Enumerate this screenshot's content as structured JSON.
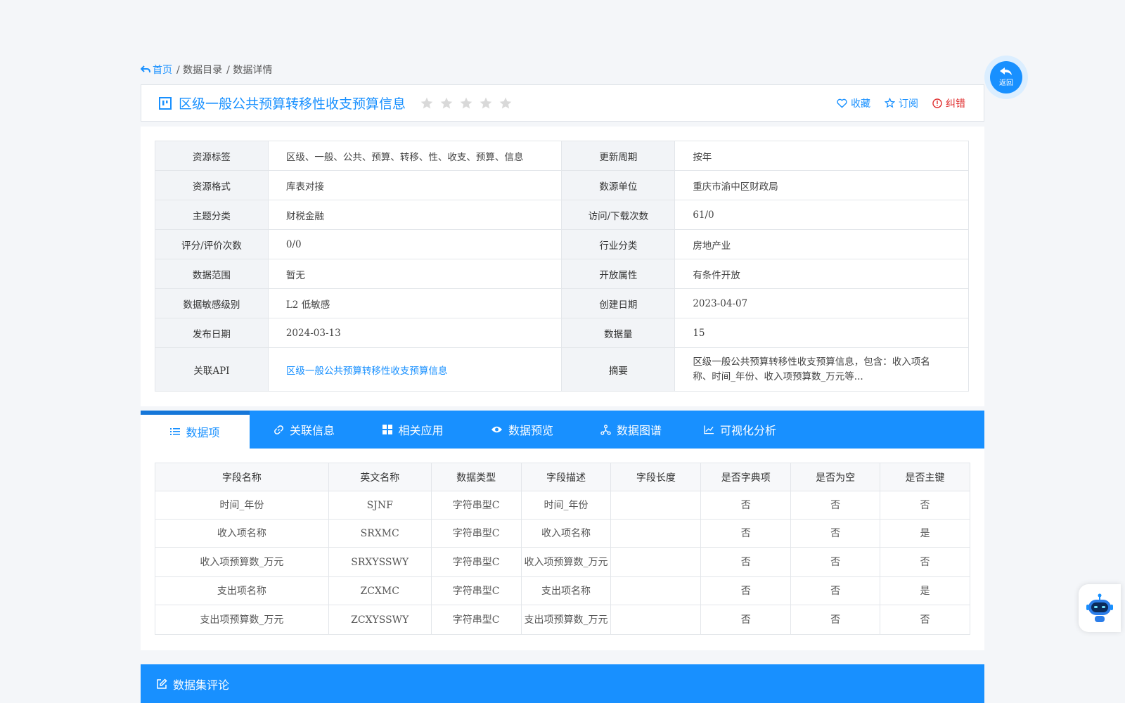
{
  "breadcrumb": {
    "home": "首页",
    "catalog": "/ 数据目录",
    "detail": "/ 数据详情"
  },
  "back_button": {
    "label": "返回"
  },
  "header": {
    "title": "区级一般公共预算转移性收支预算信息",
    "rating_stars": 0,
    "actions": {
      "favorite": "收藏",
      "subscribe": "订阅",
      "report": "纠错"
    }
  },
  "info": {
    "rows": [
      {
        "l1": "资源标签",
        "v1": "区级、一般、公共、预算、转移、性、收支、预算、信息",
        "l2": "更新周期",
        "v2": "按年"
      },
      {
        "l1": "资源格式",
        "v1": "库表对接",
        "l2": "数源单位",
        "v2": "重庆市渝中区财政局"
      },
      {
        "l1": "主题分类",
        "v1": "财税金融",
        "l2": "访问/下载次数",
        "v2": "61/0"
      },
      {
        "l1": "评分/评价次数",
        "v1": "0/0",
        "l2": "行业分类",
        "v2": "房地产业"
      },
      {
        "l1": "数据范围",
        "v1": "暂无",
        "l2": "开放属性",
        "v2": "有条件开放"
      },
      {
        "l1": "数据敏感级别",
        "v1": "L2 低敏感",
        "l2": "创建日期",
        "v2": "2023-04-07"
      },
      {
        "l1": "发布日期",
        "v1": "2024-03-13",
        "l2": "数据量",
        "v2": "15"
      }
    ],
    "api_label": "关联API",
    "api_value": "区级一般公共预算转移性收支预算信息",
    "summary_label": "摘要",
    "summary_value": "区级一般公共预算转移性收支预算信息，包含：收入项名称、时间_年份、收入项预算数_万元等..."
  },
  "tabs": [
    "数据项",
    "关联信息",
    "相关应用",
    "数据预览",
    "数据图谱",
    "可视化分析"
  ],
  "fields_table": {
    "headers": [
      "字段名称",
      "英文名称",
      "数据类型",
      "字段描述",
      "字段长度",
      "是否字典项",
      "是否为空",
      "是否主键"
    ],
    "rows": [
      [
        "时间_年份",
        "SJNF",
        "字符串型C",
        "时间_年份",
        "",
        "否",
        "否",
        "否"
      ],
      [
        "收入项名称",
        "SRXMC",
        "字符串型C",
        "收入项名称",
        "",
        "否",
        "否",
        "是"
      ],
      [
        "收入项预算数_万元",
        "SRXYSSWY",
        "字符串型C",
        "收入项预算数_万元",
        "",
        "否",
        "否",
        "否"
      ],
      [
        "支出项名称",
        "ZCXMC",
        "字符串型C",
        "支出项名称",
        "",
        "否",
        "否",
        "是"
      ],
      [
        "支出项预算数_万元",
        "ZCXYSSWY",
        "字符串型C",
        "支出项预算数_万元",
        "",
        "否",
        "否",
        "否"
      ]
    ]
  },
  "comment_section": {
    "title": "数据集评论"
  },
  "colors": {
    "primary": "#1890ff",
    "error": "#e03030",
    "star_empty": "#d9d9d9"
  }
}
